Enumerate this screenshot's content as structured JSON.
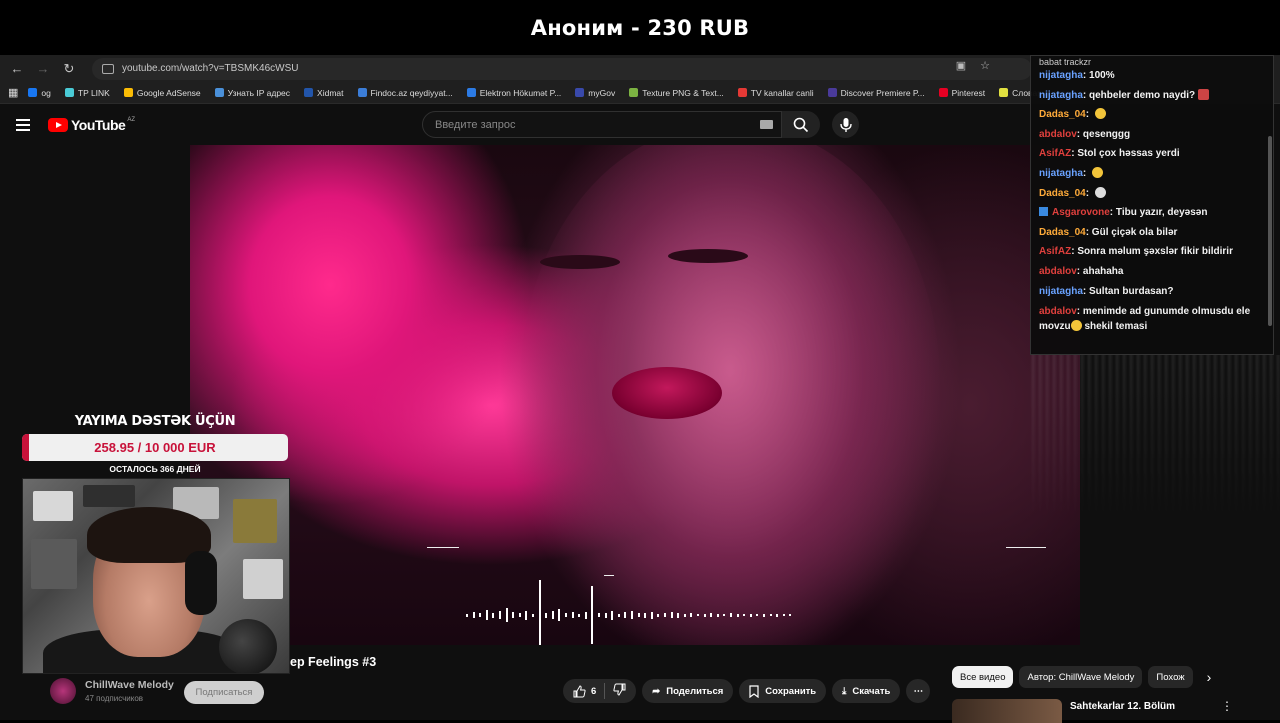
{
  "banner": {
    "text": "Аноним - 230 RUB"
  },
  "browser": {
    "url": "youtube.com/watch?v=TBSMK46cWSU",
    "bookmarks": [
      {
        "label": "og",
        "color": "#1877f2"
      },
      {
        "label": "TP LINK",
        "color": "#4acbd6"
      },
      {
        "label": "Google AdSense",
        "color": "#fbbc05"
      },
      {
        "label": "Узнать IP адрес",
        "color": "#4a90d9"
      },
      {
        "label": "Xidmat",
        "color": "#2255aa"
      },
      {
        "label": "Findoc.az qeydiyyat...",
        "color": "#3b7dd8"
      },
      {
        "label": "Elektron Hökumət P...",
        "color": "#2c7be5"
      },
      {
        "label": "myGov",
        "color": "#3949ab"
      },
      {
        "label": "Texture PNG & Text...",
        "color": "#7cb342"
      },
      {
        "label": "TV kanallar canli",
        "color": "#e53935"
      },
      {
        "label": "Discover Premiere P...",
        "color": "#4a3a9a"
      },
      {
        "label": "Pinterest",
        "color": "#e60023"
      },
      {
        "label": "Словарь игровых т...",
        "color": "#e0e040"
      }
    ]
  },
  "youtube": {
    "logo": "YouTube",
    "country": "AZ",
    "search_placeholder": "Введите запрос",
    "video_title": "ep Feelings #3",
    "channel_name": "ChillWave Melody",
    "subscribers": "47 подписчиков",
    "subscribe_label": "Подписаться",
    "likes": "6",
    "share_label": "Поделиться",
    "save_label": "Сохранить",
    "download_label": "Скачать",
    "filter_chips": [
      "Все видео",
      "Автор: ChillWave Melody",
      "Похож"
    ],
    "related_title": "Sahtekarlar 12. Bölüm"
  },
  "chat": {
    "top_clip": "babat trackzr",
    "messages": [
      {
        "user": "nijatagha",
        "color": "blue",
        "text": ": 100%"
      },
      {
        "user": "nijatagha",
        "color": "blue",
        "text": ": qehbeler demo naydi?",
        "emoji": "red"
      },
      {
        "user": "Dadas_04",
        "color": "orange",
        "text": ": ",
        "emoji": "yellow"
      },
      {
        "user": "abdalov",
        "color": "red",
        "text": ": qesenggg"
      },
      {
        "user": "AsifAZ",
        "color": "red",
        "text": ": Stol çox həssas yerdi"
      },
      {
        "user": "nijatagha",
        "color": "blue",
        "text": ": ",
        "emoji": "yellow"
      },
      {
        "user": "Dadas_04",
        "color": "orange",
        "text": ": ",
        "emoji": "white"
      },
      {
        "user": "Asgarovone",
        "color": "red",
        "text": ": Tibu yazır, deyəsən",
        "badge": true
      },
      {
        "user": "Dadas_04",
        "color": "orange",
        "text": ": Gül çiçək ola bilər"
      },
      {
        "user": "AsifAZ",
        "color": "red",
        "text": ": Sonra məlum şəxslər fikir bildirir"
      },
      {
        "user": "abdalov",
        "color": "red",
        "text": ": ahahaha"
      },
      {
        "user": "nijatagha",
        "color": "blue",
        "text": ": Sultan burdasan?"
      }
    ],
    "last_message": {
      "user": "abdalov",
      "text": ": menimde ad gunumde olmusdu ele movzu",
      "tail": " shekil temasi"
    }
  },
  "donation": {
    "title": "YAYIMA DƏSTƏK ÜÇÜN",
    "amount": "258.95 / 10 000 EUR",
    "progress_fraction": 0.026,
    "days_left": "ОСТАЛОСЬ 366 ДНЕЙ"
  },
  "colors": {
    "accent_red": "#c8123a",
    "yt_red": "#ff0000",
    "video_pink": "#e0167a"
  }
}
